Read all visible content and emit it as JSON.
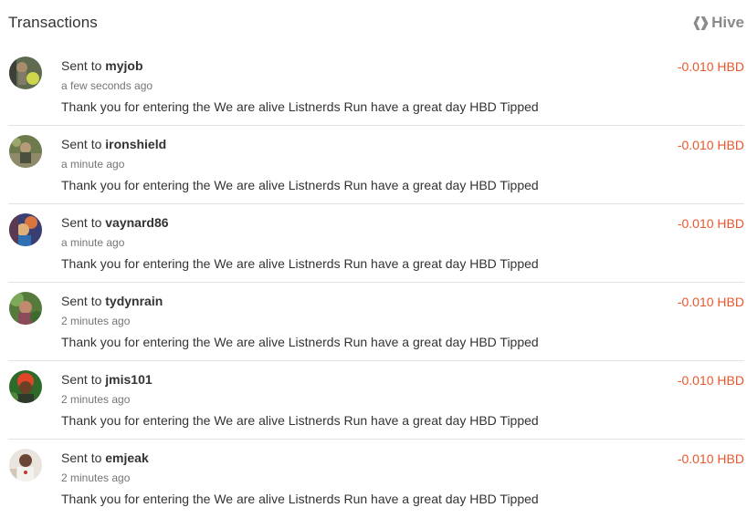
{
  "header": {
    "title": "Transactions",
    "brand": "Hive",
    "brand_icon": "hive-logo-icon"
  },
  "colors": {
    "amount": "#e8572c",
    "divider": "#e2e2e2",
    "muted": "#757575",
    "brand": "#8a8a8a"
  },
  "transactions": [
    {
      "prefix": "Sent to",
      "user": "myjob",
      "time": "a few seconds ago",
      "memo": "Thank you for entering the We are alive Listnerds Run have a great day HBD Tipped",
      "amount": "-0.010 HBD",
      "avatar": "user-avatar-myjob"
    },
    {
      "prefix": "Sent to",
      "user": "ironshield",
      "time": "a minute ago",
      "memo": "Thank you for entering the We are alive Listnerds Run have a great day HBD Tipped",
      "amount": "-0.010 HBD",
      "avatar": "user-avatar-ironshield"
    },
    {
      "prefix": "Sent to",
      "user": "vaynard86",
      "time": "a minute ago",
      "memo": "Thank you for entering the We are alive Listnerds Run have a great day HBD Tipped",
      "amount": "-0.010 HBD",
      "avatar": "user-avatar-vaynard86"
    },
    {
      "prefix": "Sent to",
      "user": "tydynrain",
      "time": "2 minutes ago",
      "memo": "Thank you for entering the We are alive Listnerds Run have a great day HBD Tipped",
      "amount": "-0.010 HBD",
      "avatar": "user-avatar-tydynrain"
    },
    {
      "prefix": "Sent to",
      "user": "jmis101",
      "time": "2 minutes ago",
      "memo": "Thank you for entering the We are alive Listnerds Run have a great day HBD Tipped",
      "amount": "-0.010 HBD",
      "avatar": "user-avatar-jmis101"
    },
    {
      "prefix": "Sent to",
      "user": "emjeak",
      "time": "2 minutes ago",
      "memo": "Thank you for entering the We are alive Listnerds Run have a great day HBD Tipped",
      "amount": "-0.010 HBD",
      "avatar": "user-avatar-emjeak"
    }
  ]
}
